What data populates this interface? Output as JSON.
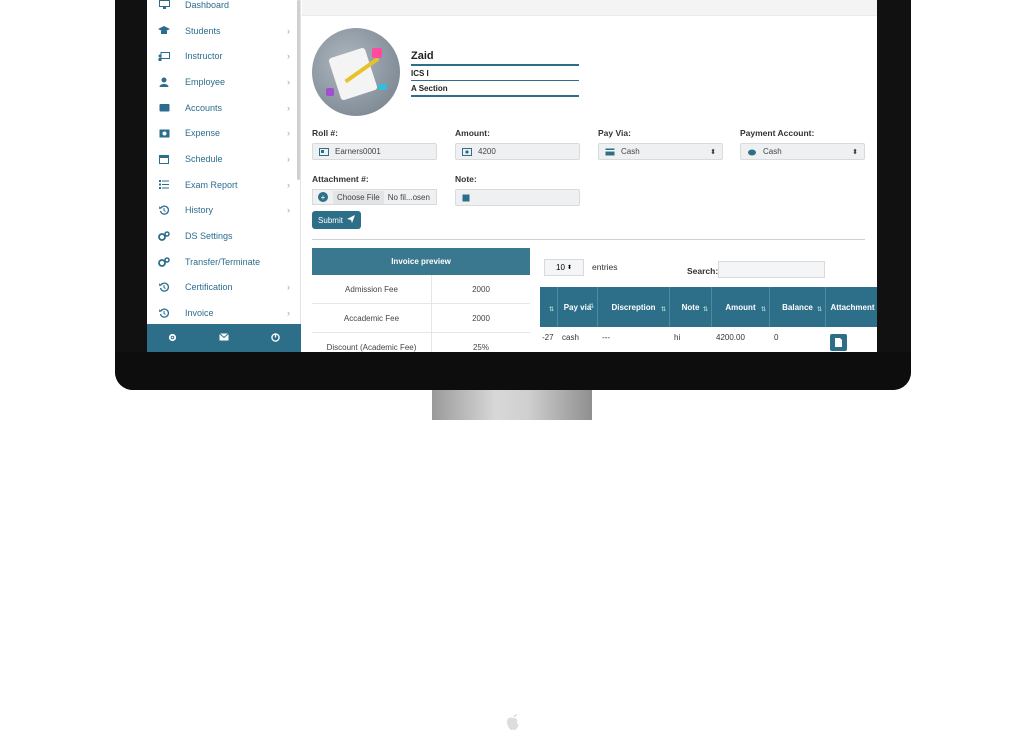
{
  "sidebar": {
    "items": [
      {
        "label": "Dashboard",
        "icon": "monitor-icon",
        "chevron": false
      },
      {
        "label": "Students",
        "icon": "graduation-cap-icon",
        "chevron": true
      },
      {
        "label": "Instructor",
        "icon": "chalkboard-teacher-icon",
        "chevron": true
      },
      {
        "label": "Employee",
        "icon": "user-tie-icon",
        "chevron": true
      },
      {
        "label": "Accounts",
        "icon": "wallet-icon",
        "chevron": true
      },
      {
        "label": "Expense",
        "icon": "expense-icon",
        "chevron": true
      },
      {
        "label": "Schedule",
        "icon": "calendar-icon",
        "chevron": true
      },
      {
        "label": "Exam Report",
        "icon": "list-icon",
        "chevron": true
      },
      {
        "label": "History",
        "icon": "history-icon",
        "chevron": true
      },
      {
        "label": "DS Settings",
        "icon": "cogs-icon",
        "chevron": false
      },
      {
        "label": "Transfer/Terminate",
        "icon": "cogs-icon",
        "chevron": false
      },
      {
        "label": "Certification",
        "icon": "history-icon",
        "chevron": true
      },
      {
        "label": "Invoice",
        "icon": "history-icon",
        "chevron": true
      }
    ],
    "footer_icons": [
      "gear-icon",
      "envelope-icon",
      "power-icon"
    ]
  },
  "profile": {
    "name": "Zaid",
    "class": "ICS I",
    "section": "A Section"
  },
  "form": {
    "roll_label": "Roll #:",
    "roll_value": "Earners0001",
    "amount_label": "Amount:",
    "amount_value": "4200",
    "payvia_label": "Pay Via:",
    "payvia_value": "Cash",
    "payment_account_label": "Payment Account:",
    "payment_account_value": "Cash",
    "attachment_label": "Attachment #:",
    "choose_file": "Choose File",
    "no_file": "No fil...osen",
    "note_label": "Note:",
    "note_value": "",
    "submit_label": "Submit"
  },
  "invoice_preview": {
    "title": "Invoice preview",
    "rows": [
      {
        "label": "Admission Fee",
        "value": "2000"
      },
      {
        "label": "Accademic Fee",
        "value": "2000"
      },
      {
        "label": "Discount (Academic Fee)",
        "value": "25%"
      }
    ]
  },
  "table": {
    "entries_value": "10",
    "entries_label": "entries",
    "search_label": "Search:",
    "columns": [
      "",
      "Pay via",
      "Discreption",
      "Note",
      "Amount",
      "Balance",
      "Attachment"
    ],
    "rows": [
      {
        "id": "-27",
        "payvia": "cash",
        "desc": "---",
        "note": "hi",
        "amount": "4200.00",
        "balance": "0"
      }
    ]
  },
  "colors": {
    "accent": "#2d6f89",
    "sidebar_text": "#2c6d8f"
  }
}
